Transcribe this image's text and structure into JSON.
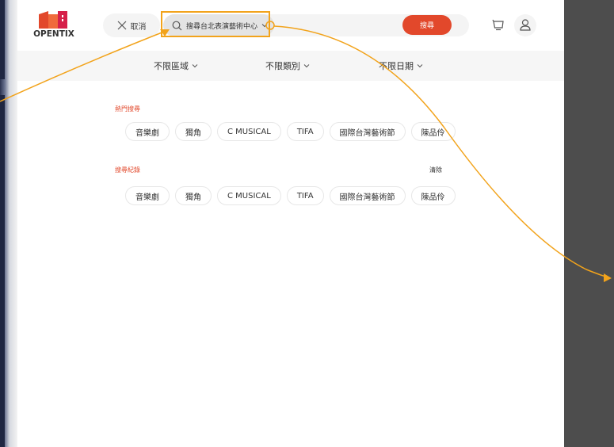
{
  "brand": {
    "logo_text": "OPENTIX",
    "accent": "#e2482b"
  },
  "header": {
    "cancel_label": "取消",
    "search_value": "搜尋台北表演藝術中心",
    "search_button": "搜尋",
    "icons": {
      "cancel": "close-icon",
      "search": "search-icon",
      "cart": "cart-icon",
      "user": "user-icon"
    }
  },
  "filters": [
    {
      "label": "不限區域"
    },
    {
      "label": "不限類別"
    },
    {
      "label": "不限日期"
    }
  ],
  "hot_search": {
    "title": "熱門搜尋",
    "chips": [
      "音樂劇",
      "獨角",
      "C MUSICAL",
      "TIFA",
      "國際台灣藝術節",
      "陳品伶"
    ]
  },
  "search_history": {
    "title": "搜尋紀錄",
    "clear_label": "清除",
    "chips": [
      "音樂劇",
      "獨角",
      "C MUSICAL",
      "TIFA",
      "國際台灣藝術節",
      "陳品伶"
    ]
  },
  "annotation": {
    "color": "#f2a31b"
  },
  "colors": {
    "right_panel": "#4d4d4d",
    "filter_bar": "#f6f6f6"
  }
}
